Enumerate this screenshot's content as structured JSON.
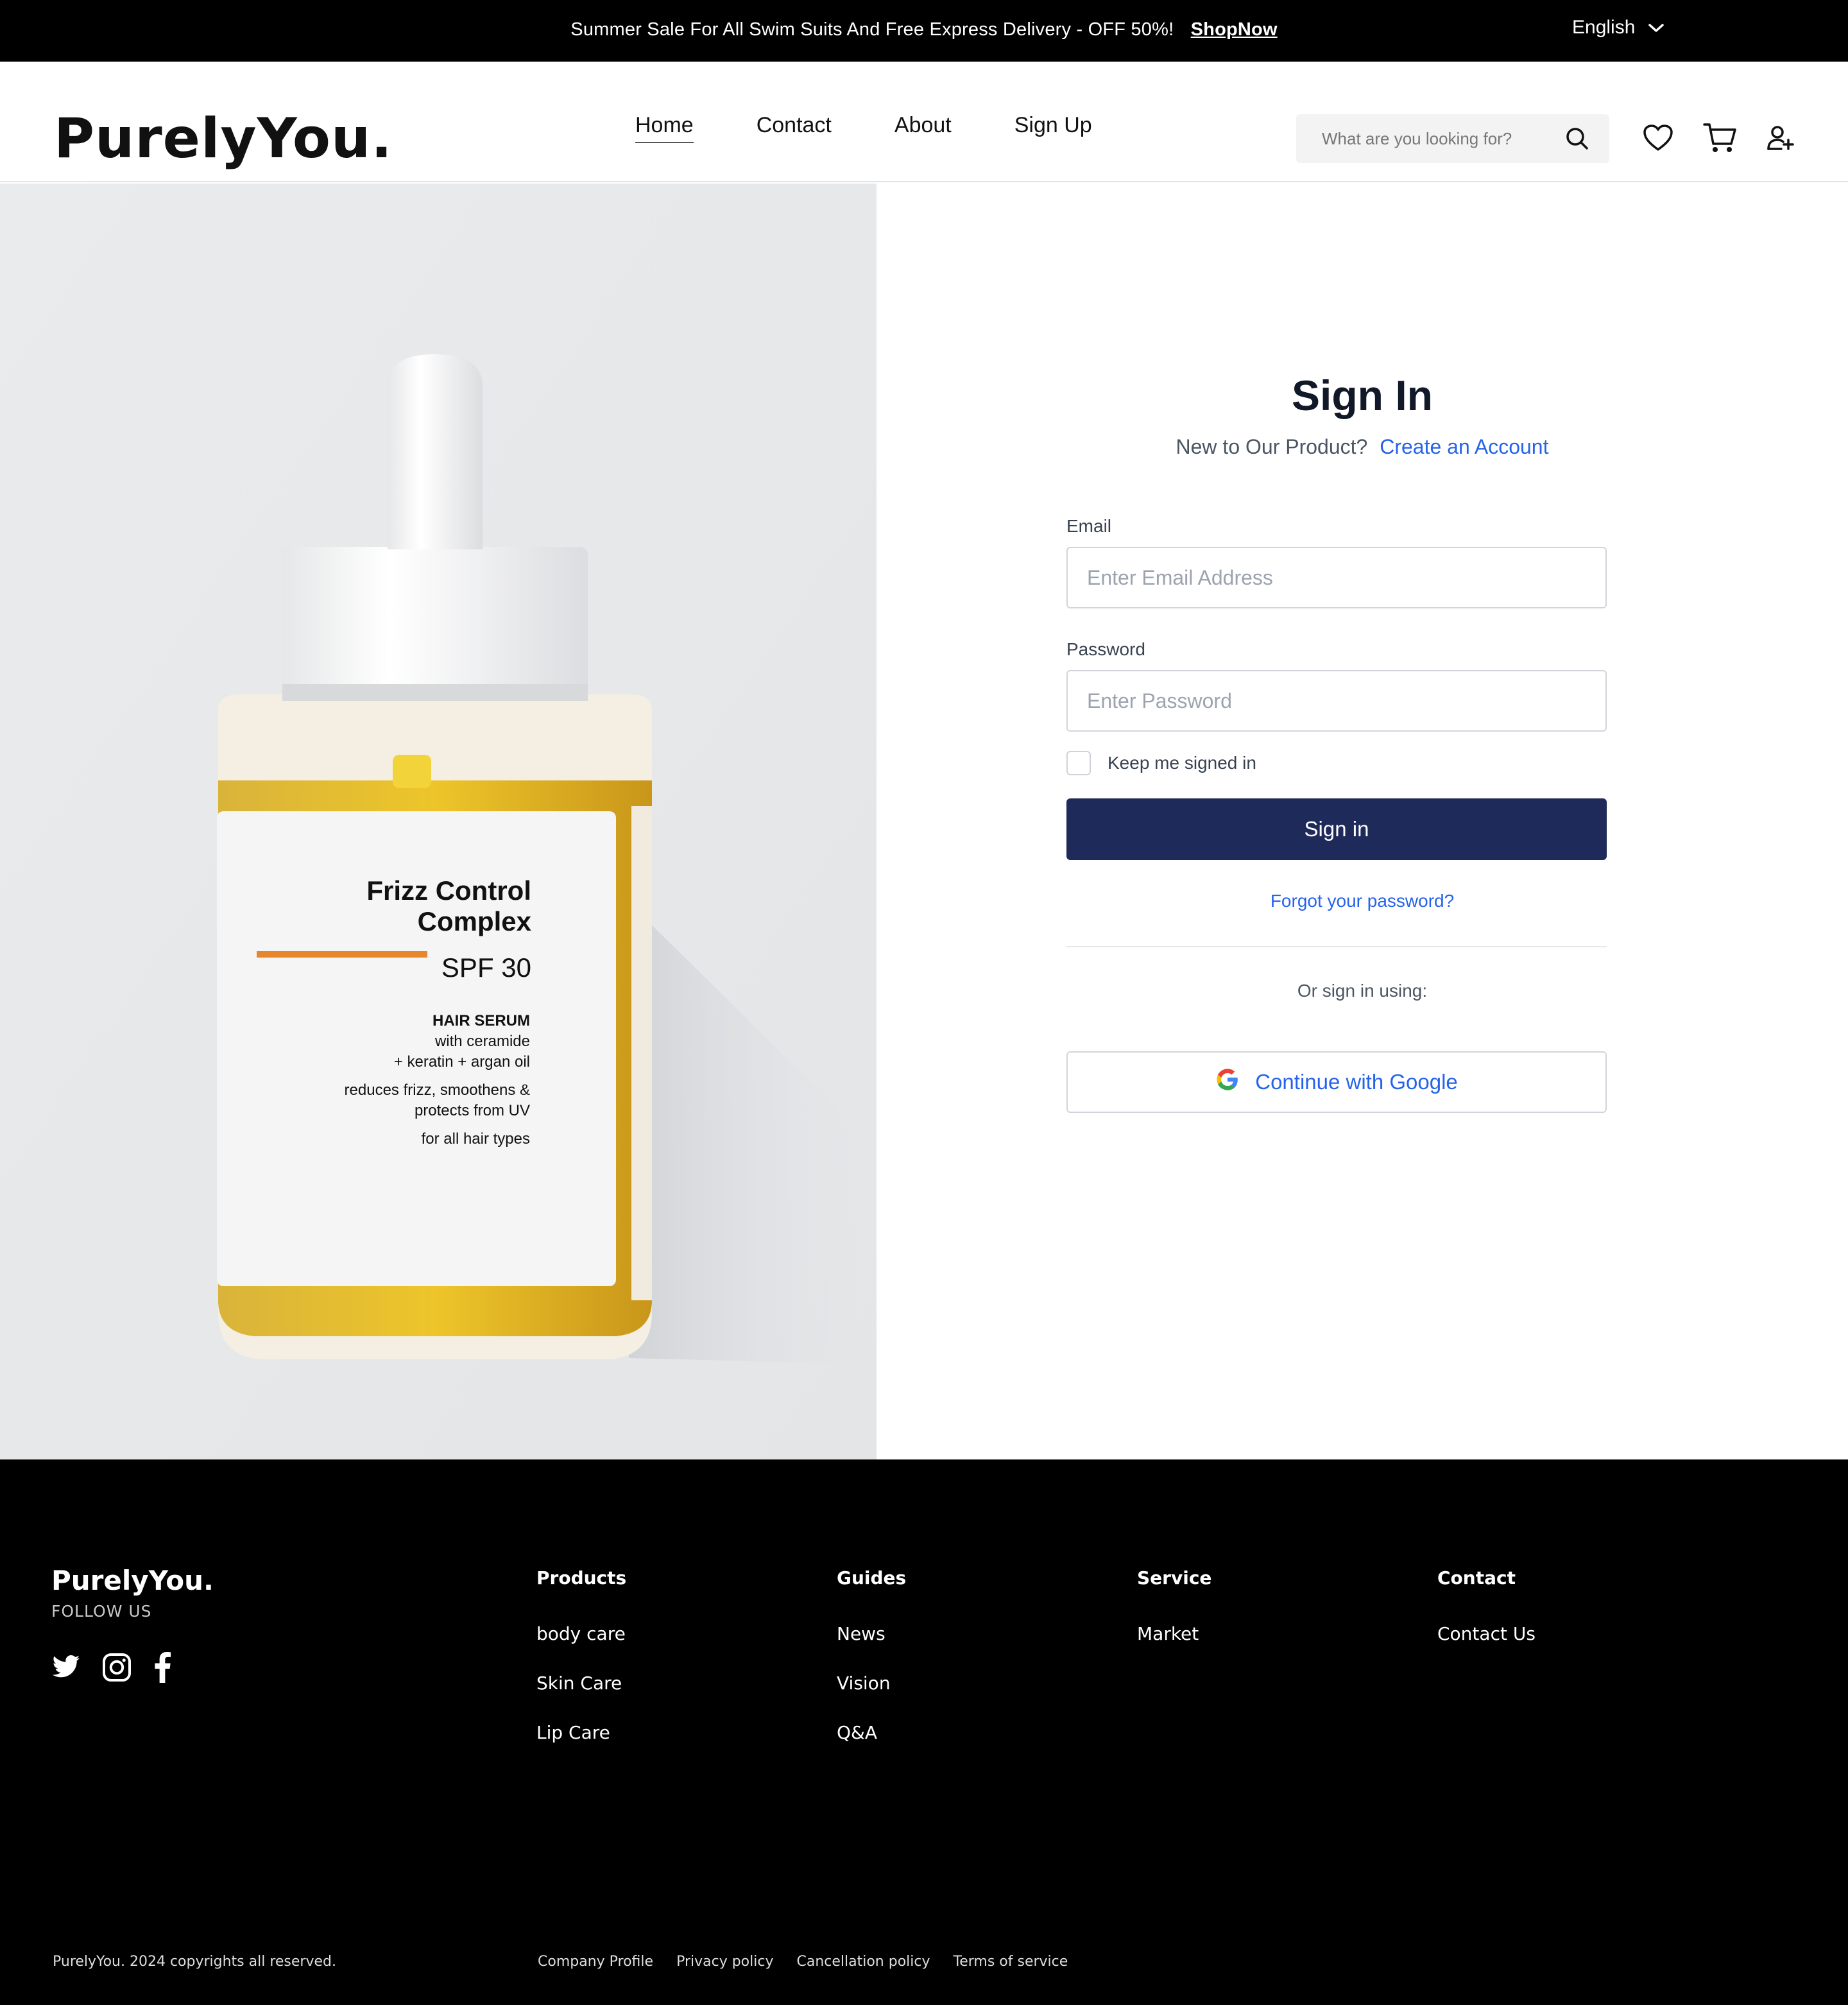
{
  "topbar": {
    "promo_text": "Summer Sale For All Swim Suits And Free Express Delivery - OFF 50%!",
    "promo_link": "ShopNow",
    "language": "English"
  },
  "header": {
    "logo": "PurelyYou.",
    "nav": [
      "Home",
      "Contact",
      "About",
      "Sign Up"
    ],
    "active_nav": "Home",
    "search_placeholder": "What are you looking for?",
    "icons": [
      "search-icon",
      "heart-icon",
      "cart-icon",
      "user-add-icon"
    ]
  },
  "hero": {
    "product_name_line1": "Frizz Control",
    "product_name_line2": "Complex",
    "spf": "SPF 30",
    "type": "HAIR SERUM",
    "line1": "with ceramide",
    "line2": "+ keratin + argan oil",
    "line3": "reduces frizz, smoothens &",
    "line4": "protects from UV",
    "line5": "for all hair types",
    "accent_color": "#e8862b",
    "serum_color": "#e4b21c"
  },
  "signin": {
    "title": "Sign In",
    "subtitle": "New to Our Product?",
    "create_account": "Create an Account",
    "email_label": "Email",
    "email_placeholder": "Enter Email Address",
    "password_label": "Password",
    "password_placeholder": "Enter Password",
    "keep_signed_in": "Keep me signed in",
    "submit": "Sign in",
    "forgot": "Forgot your password?",
    "or_text": "Or sign in using:",
    "google": "Continue with Google",
    "primary_color": "#1e2a5a",
    "link_color": "#2563eb"
  },
  "footer": {
    "logo": "PurelyYou.",
    "follow": "FOLLOW US",
    "social_icons": [
      "twitter-icon",
      "instagram-icon",
      "facebook-icon"
    ],
    "columns": [
      {
        "title": "Products",
        "items": [
          "body care",
          "Skin Care",
          "Lip Care"
        ]
      },
      {
        "title": "Guides",
        "items": [
          "News",
          "Vision",
          "Q&A"
        ]
      },
      {
        "title": "Service",
        "items": [
          "Market"
        ]
      },
      {
        "title": "Contact",
        "items": [
          "Contact Us"
        ]
      }
    ],
    "copyright": "PurelyYou. 2024 copyrights all reserved.",
    "links": [
      "Company Profile",
      "Privacy policy",
      "Cancellation policy",
      "Terms of service"
    ]
  }
}
